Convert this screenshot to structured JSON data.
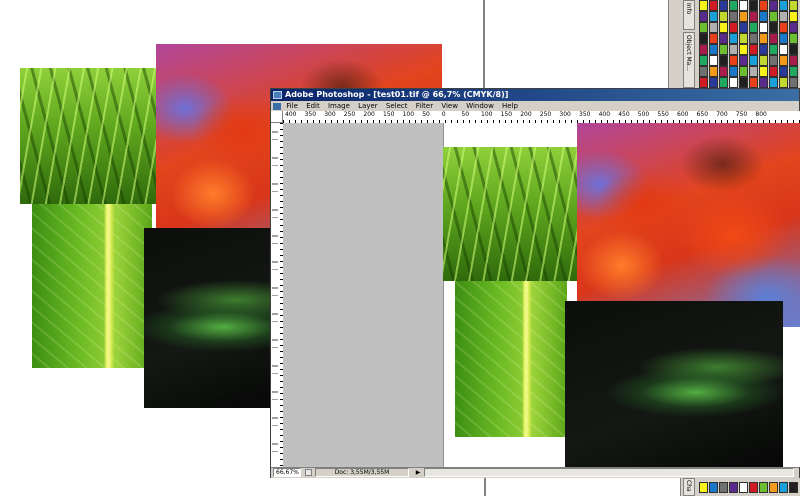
{
  "window": {
    "title": "Adobe Photoshop - [test01.tif @ 66,7% (CMYK/8)]"
  },
  "menu": [
    "File",
    "Edit",
    "Image",
    "Layer",
    "Select",
    "Filter",
    "View",
    "Window",
    "Help"
  ],
  "ruler": {
    "h_labels": [
      "400",
      "350",
      "300",
      "250",
      "200",
      "150",
      "100",
      "50",
      "0",
      "50",
      "100",
      "150",
      "200",
      "250",
      "300",
      "350",
      "400",
      "450",
      "500",
      "550",
      "600",
      "650",
      "700",
      "750",
      "800"
    ]
  },
  "status": {
    "zoom": "66,67%",
    "doc": "Doc: 3,55M/3,55M",
    "arrow": "▶"
  },
  "palette": {
    "tab_top": "Info",
    "tab_mid": "Object Ma...",
    "tab_bottom": "Cha",
    "colors": [
      "#f7f218",
      "#f39a1a",
      "#e8401a",
      "#d01a24",
      "#a81c4c",
      "#5a2a8c",
      "#2a3a9a",
      "#1a78c8",
      "#1aa0d8",
      "#20a860",
      "#6abe30",
      "#c0d830",
      "#ffffff",
      "#b0b0b0",
      "#707070",
      "#202020"
    ]
  },
  "images": {
    "grass": "green grass photo",
    "maple": "red maple leaves photo",
    "leaf": "green leaf macro photo",
    "dark": "dark leaves with dew photo"
  }
}
